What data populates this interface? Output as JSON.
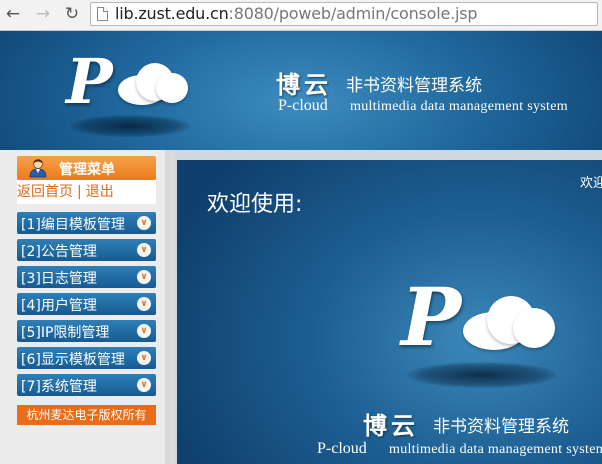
{
  "browser": {
    "url_host": "lib.zust.edu.cn",
    "url_rest": ":8080/poweb/admin/console.jsp"
  },
  "header": {
    "logo_letter": "P",
    "brand_cn": "博云",
    "brand_subtitle": "非书资料管理系统",
    "brand_en_name": "P-cloud",
    "brand_en_tagline": "multimedia data management system"
  },
  "sidebar": {
    "title": "管理菜单",
    "home_link": "返回首页",
    "separator": "|",
    "logout_link": "退出",
    "items": [
      {
        "label": "[1]编目模板管理"
      },
      {
        "label": "[2]公告管理"
      },
      {
        "label": "[3]日志管理"
      },
      {
        "label": "[4]用户管理"
      },
      {
        "label": "[5]IP限制管理"
      },
      {
        "label": "[6]显示模板管理"
      },
      {
        "label": "[7]系统管理"
      }
    ],
    "copyright": "杭州麦达电子版权所有"
  },
  "main": {
    "welcome": "欢迎使用:",
    "welcome_right": "欢迎",
    "logo_letter": "P",
    "brand_cn": "博云",
    "brand_subtitle": "非书资料管理系统",
    "brand_en_name": "P-cloud",
    "brand_en_tagline": "multimedia data management system"
  },
  "icons": {
    "back": "back-arrow-icon",
    "forward": "forward-arrow-icon",
    "reload": "reload-icon",
    "page": "page-icon",
    "admin": "admin-user-icon",
    "chevron": "double-chevron-down-icon"
  },
  "colors": {
    "accent_orange": "#ea7b1c",
    "menu_blue": "#1d66a0",
    "banner_blue": "#20699e"
  }
}
